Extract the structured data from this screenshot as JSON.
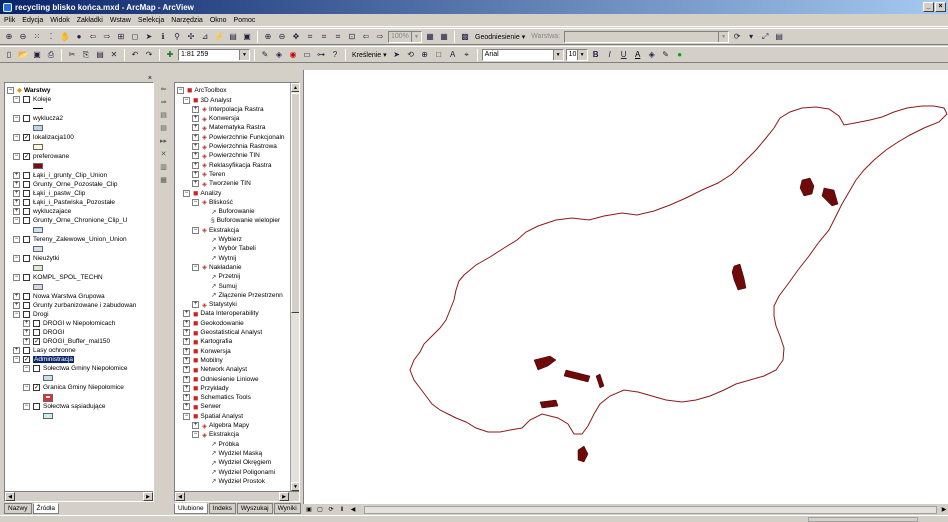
{
  "window": {
    "title": "recycling blisko końca.mxd - ArcMap - ArcView",
    "min_label": "_",
    "close_label": "×"
  },
  "menu": [
    "Plik",
    "Edycja",
    "Widok",
    "Zakładki",
    "Wstaw",
    "Selekcja",
    "Narzędzia",
    "Okno",
    "Pomoc"
  ],
  "toolbar1": {
    "zoom_value": "100%",
    "georef_label": "Geodniesienie ▾",
    "layer_label": "Warstwa:",
    "layer_value": ""
  },
  "toolbar2": {
    "scale_value": "1:81 259",
    "draw_label": "Kreślenie ▾",
    "font_value": "Arial",
    "size_value": "10",
    "bold": "B",
    "italic": "I",
    "underline": "U",
    "text_a": "A"
  },
  "toc": {
    "root": "Warstwy",
    "layers": [
      {
        "label": "Koleje",
        "checked": false,
        "expanded": true,
        "indent": 0
      },
      {
        "label": "wyklucza2",
        "checked": false,
        "expanded": true,
        "indent": 0
      },
      {
        "label": "lokalizacja100",
        "checked": true,
        "expanded": true,
        "indent": 0
      },
      {
        "label": "preferowane",
        "checked": true,
        "expanded": true,
        "indent": 0
      },
      {
        "label": "Łąki_i_grunty_Clip_Union",
        "checked": false,
        "expanded": false,
        "indent": 0
      },
      {
        "label": "Grunty_Orne_Pozostałe_Clip",
        "checked": false,
        "expanded": false,
        "indent": 0
      },
      {
        "label": "Łąki_i_pastw_Clip",
        "checked": false,
        "expanded": false,
        "indent": 0
      },
      {
        "label": "Łąki_i_Pastwiska_Pozostałe",
        "checked": false,
        "expanded": false,
        "indent": 0
      },
      {
        "label": "wykluczajace",
        "checked": false,
        "expanded": false,
        "indent": 0
      },
      {
        "label": "Grunty_Orne_Chronione_Clip_U",
        "checked": false,
        "expanded": true,
        "indent": 0
      },
      {
        "label": "Tereny_Zalewowe_Union_Union",
        "checked": false,
        "expanded": true,
        "indent": 0
      },
      {
        "label": "Nieużytki",
        "checked": false,
        "expanded": true,
        "indent": 0
      },
      {
        "label": "KOMPL_SPOL_TECHN",
        "checked": false,
        "expanded": true,
        "indent": 0
      },
      {
        "label": "Nowa Warstwa Grupowa",
        "checked": false,
        "expanded": false,
        "indent": 0
      },
      {
        "label": "Grunty zurbanizowane i zabudowan",
        "checked": false,
        "expanded": false,
        "indent": 0
      },
      {
        "label": "Drogi",
        "checked": false,
        "expanded": true,
        "indent": 0
      },
      {
        "label": "DROGI w Niepołomicach",
        "checked": false,
        "expanded": false,
        "indent": 1
      },
      {
        "label": "DROGI",
        "checked": false,
        "expanded": false,
        "indent": 1
      },
      {
        "label": "DROGI_Buffer_mal150",
        "checked": true,
        "expanded": false,
        "indent": 1
      },
      {
        "label": "Lasy ochronne",
        "checked": false,
        "expanded": false,
        "indent": 0
      },
      {
        "label": "Administracja",
        "checked": true,
        "expanded": true,
        "indent": 0
      },
      {
        "label": "Sołectwa Gminy Niepołomice",
        "checked": false,
        "expanded": true,
        "indent": 1
      },
      {
        "label": "Granica Gminy Niepołomice",
        "checked": true,
        "expanded": true,
        "indent": 1
      },
      {
        "label": "Sołectwa sąsiadujące",
        "checked": false,
        "expanded": true,
        "indent": 1
      }
    ],
    "tabs": [
      "Nazwy",
      "Źródła"
    ]
  },
  "toolbox": {
    "root": "ArcToolbox",
    "items": [
      {
        "label": "3D Analyst",
        "type": "box",
        "exp": "−",
        "indent": 0
      },
      {
        "label": "Interpolacja Rastra",
        "type": "set",
        "exp": "+",
        "indent": 1
      },
      {
        "label": "Konwersja",
        "type": "set",
        "exp": "+",
        "indent": 1
      },
      {
        "label": "Matematyka Rastra",
        "type": "set",
        "exp": "+",
        "indent": 1
      },
      {
        "label": "Powierzchnie Funkcjonaln",
        "type": "set",
        "exp": "+",
        "indent": 1
      },
      {
        "label": "Powierzchnia Rastrowa",
        "type": "set",
        "exp": "+",
        "indent": 1
      },
      {
        "label": "Powierzchnie TIN",
        "type": "set",
        "exp": "+",
        "indent": 1
      },
      {
        "label": "Reklasyfikacja Rastra",
        "type": "set",
        "exp": "+",
        "indent": 1
      },
      {
        "label": "Teren",
        "type": "set",
        "exp": "+",
        "indent": 1
      },
      {
        "label": "Tworzenie TIN",
        "type": "set",
        "exp": "+",
        "indent": 1
      },
      {
        "label": "Analizy",
        "type": "box",
        "exp": "−",
        "indent": 0
      },
      {
        "label": "Bliskość",
        "type": "set",
        "exp": "−",
        "indent": 1
      },
      {
        "label": "Buforowanie",
        "type": "tool",
        "exp": "",
        "indent": 2
      },
      {
        "label": "Buforowanie wielopier",
        "type": "script",
        "exp": "",
        "indent": 2
      },
      {
        "label": "Ekstrakcja",
        "type": "set",
        "exp": "−",
        "indent": 1
      },
      {
        "label": "Wybierz",
        "type": "tool",
        "exp": "",
        "indent": 2
      },
      {
        "label": "Wybór Tabeli",
        "type": "tool",
        "exp": "",
        "indent": 2
      },
      {
        "label": "Wytnij",
        "type": "tool",
        "exp": "",
        "indent": 2
      },
      {
        "label": "Nakładanie",
        "type": "set",
        "exp": "−",
        "indent": 1
      },
      {
        "label": "Przetnij",
        "type": "tool",
        "exp": "",
        "indent": 2
      },
      {
        "label": "Sumuj",
        "type": "tool",
        "exp": "",
        "indent": 2
      },
      {
        "label": "Złączenie Przestrzenn",
        "type": "tool",
        "exp": "",
        "indent": 2
      },
      {
        "label": "Statystyki",
        "type": "set",
        "exp": "+",
        "indent": 1
      },
      {
        "label": "Data Interoperability",
        "type": "box",
        "exp": "+",
        "indent": 0
      },
      {
        "label": "Geokodowanie",
        "type": "box",
        "exp": "+",
        "indent": 0
      },
      {
        "label": "Geostatistical Analyst",
        "type": "box",
        "exp": "+",
        "indent": 0
      },
      {
        "label": "Kartografia",
        "type": "box",
        "exp": "+",
        "indent": 0
      },
      {
        "label": "Konwersja",
        "type": "box",
        "exp": "+",
        "indent": 0
      },
      {
        "label": "Mobilny",
        "type": "box",
        "exp": "+",
        "indent": 0
      },
      {
        "label": "Network Analyst",
        "type": "box",
        "exp": "+",
        "indent": 0
      },
      {
        "label": "Odniesienie Liniowe",
        "type": "box",
        "exp": "+",
        "indent": 0
      },
      {
        "label": "Przykłady",
        "type": "box",
        "exp": "+",
        "indent": 0
      },
      {
        "label": "Schematics Tools",
        "type": "box",
        "exp": "+",
        "indent": 0
      },
      {
        "label": "Serwer",
        "type": "box",
        "exp": "+",
        "indent": 0
      },
      {
        "label": "Spatial Analyst",
        "type": "box",
        "exp": "−",
        "indent": 0
      },
      {
        "label": "Algebra Mapy",
        "type": "set",
        "exp": "+",
        "indent": 1
      },
      {
        "label": "Ekstrakcja",
        "type": "set",
        "exp": "−",
        "indent": 1
      },
      {
        "label": "Próbka",
        "type": "tool",
        "exp": "",
        "indent": 2
      },
      {
        "label": "Wydziel Maską",
        "type": "tool",
        "exp": "",
        "indent": 2
      },
      {
        "label": "Wydziel Okręgiem",
        "type": "tool",
        "exp": "",
        "indent": 2
      },
      {
        "label": "Wydziel Poligonami",
        "type": "tool",
        "exp": "",
        "indent": 2
      },
      {
        "label": "Wydziel Prostok",
        "type": "tool",
        "exp": "",
        "indent": 2
      }
    ],
    "tabs": [
      "Ulubione",
      "Indeks",
      "Wyszukaj",
      "Wyniki"
    ]
  },
  "colors": {
    "boundary": "#8b1a1a",
    "parcel": "#6e0a0a",
    "solectwa_swatch": "#c6e0f0",
    "wyklucza2_swatch": "#b8d8ef",
    "lokalizacja_swatch": "#fdfbd0",
    "preferowane_swatch": "#7a0f0f",
    "granica_swatch": "#e52d2d"
  }
}
